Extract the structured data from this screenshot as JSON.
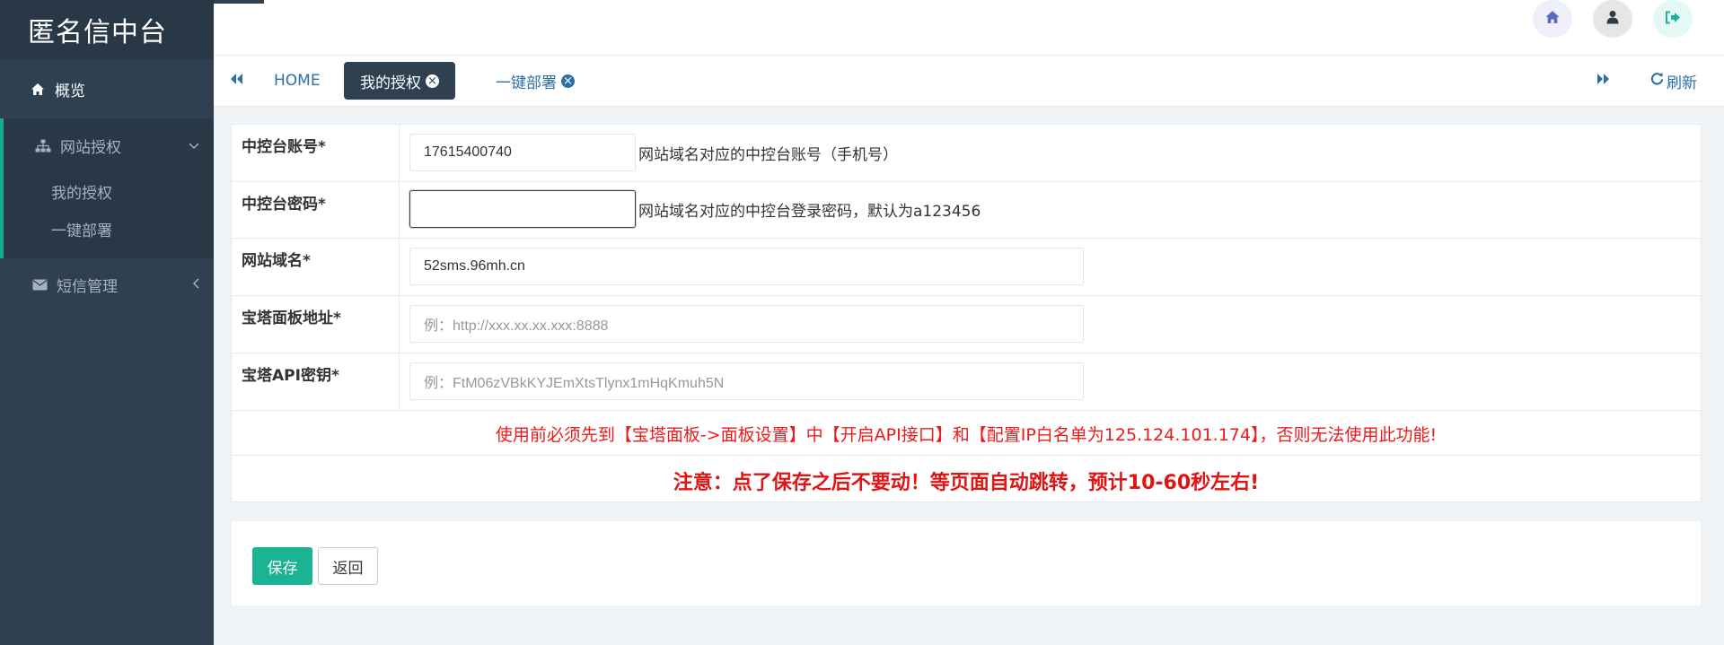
{
  "app": {
    "title": "匿名信中台"
  },
  "sidebar": {
    "overview": "概览",
    "site_auth": "网站授权",
    "sub_items": [
      "我的授权",
      "一键部署"
    ],
    "sms": "短信管理"
  },
  "tabs": {
    "home": "HOME",
    "active": "我的授权",
    "other": "一键部署",
    "refresh": "刷新"
  },
  "form": {
    "rows": [
      {
        "label": "中控台账号*",
        "value": "17615400740",
        "placeholder": "",
        "hint": "网站域名对应的中控台账号（手机号）"
      },
      {
        "label": "中控台密码*",
        "value": "",
        "placeholder": "",
        "hint": "网站域名对应的中控台登录密码，默认为a123456"
      },
      {
        "label": "网站域名*",
        "value": "52sms.96mh.cn",
        "placeholder": "",
        "hint": ""
      },
      {
        "label": "宝塔面板地址*",
        "value": "",
        "placeholder": "例：http://xxx.xx.xx.xxx:8888",
        "hint": ""
      },
      {
        "label": "宝塔API密钥*",
        "value": "",
        "placeholder": "例：FtM06zVBkKYJEmXtsTlynx1mHqKmuh5N",
        "hint": ""
      }
    ],
    "notice": "使用前必须先到【宝塔面板->面板设置】中【开启API接口】和【配置IP白名单为125.124.101.174】，否则无法使用此功能!",
    "warning": "注意：点了保存之后不要动！等页面自动跳转，预计10-60秒左右!"
  },
  "actions": {
    "save": "保存",
    "back": "返回"
  },
  "colors": {
    "sidebar_bg": "#2f4050",
    "accent": "#1ab394",
    "link": "#2c6fa5",
    "danger": "#ee1a1a"
  }
}
